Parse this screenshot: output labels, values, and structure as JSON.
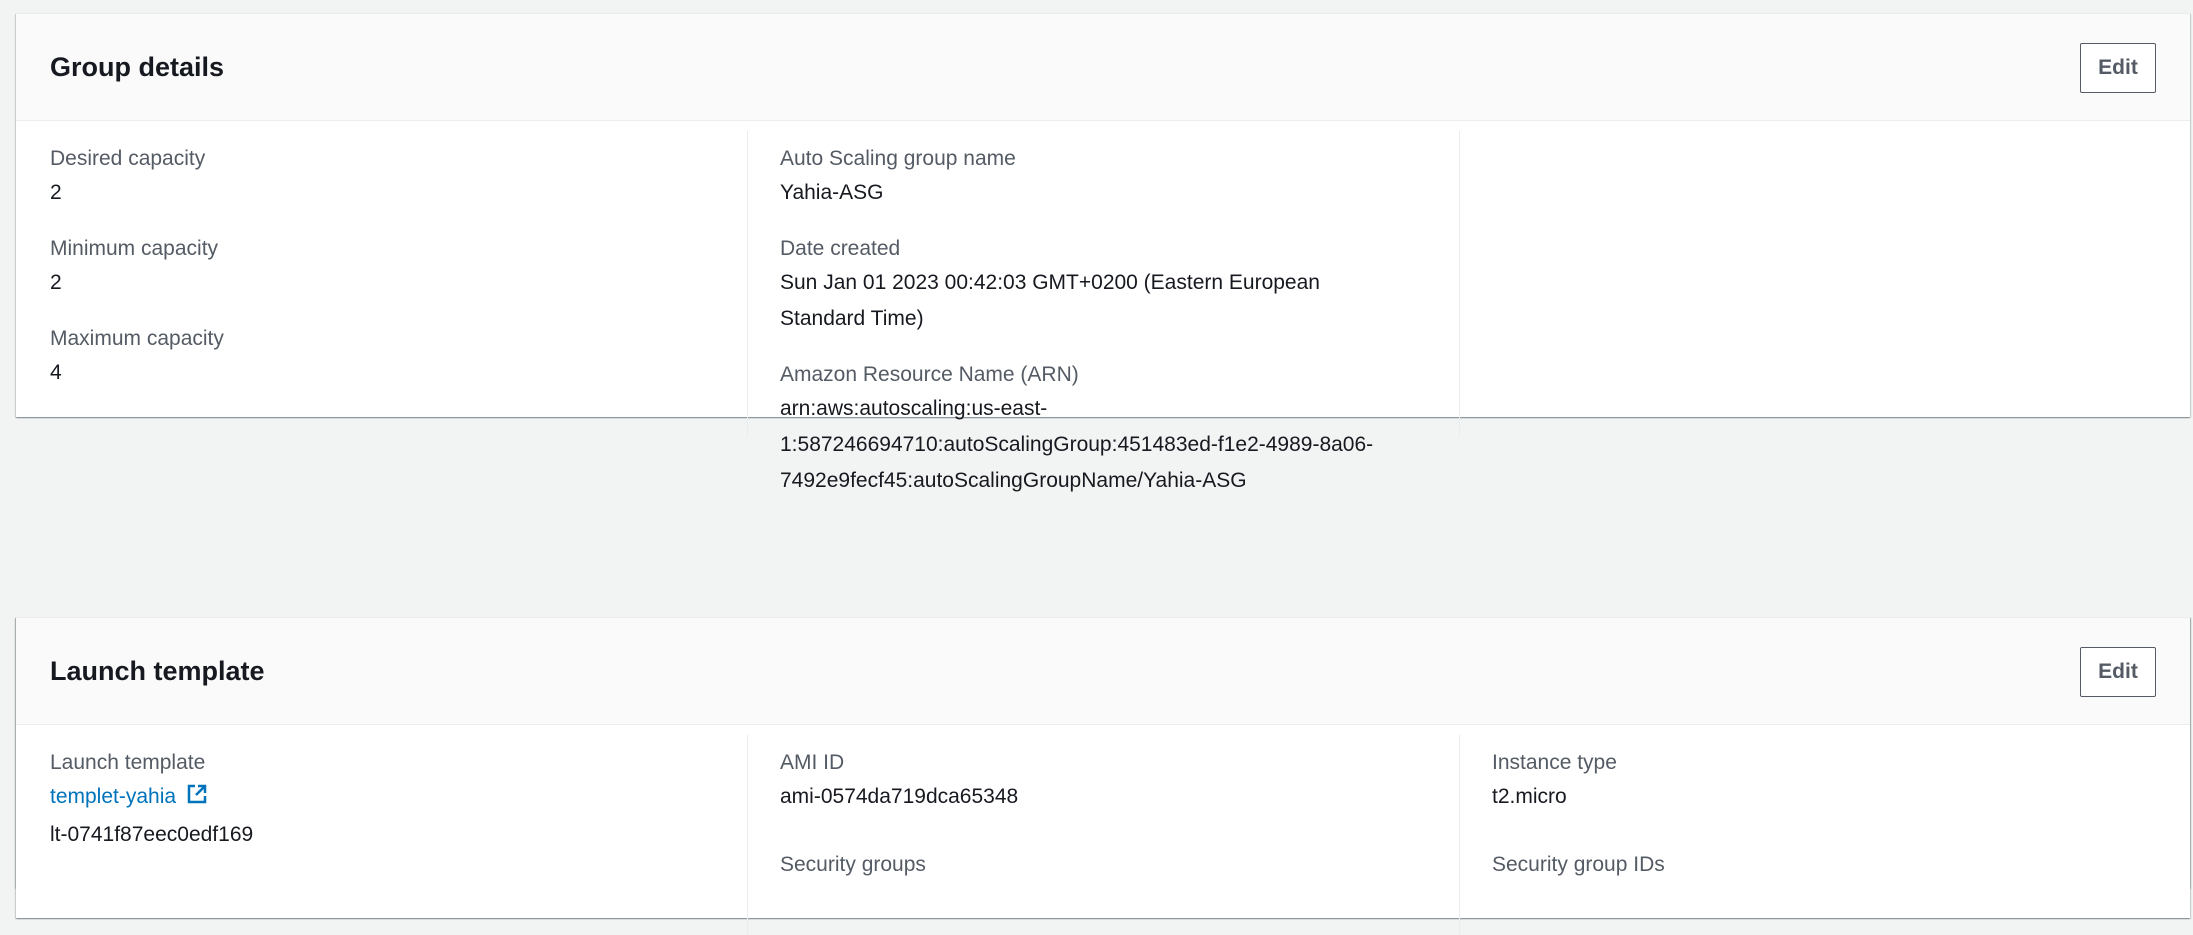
{
  "group_details": {
    "title": "Group details",
    "edit_label": "Edit",
    "col1": {
      "desired_capacity_label": "Desired capacity",
      "desired_capacity_value": "2",
      "minimum_capacity_label": "Minimum capacity",
      "minimum_capacity_value": "2",
      "maximum_capacity_label": "Maximum capacity",
      "maximum_capacity_value": "4"
    },
    "col2": {
      "asg_name_label": "Auto Scaling group name",
      "asg_name_value": "Yahia-ASG",
      "date_created_label": "Date created",
      "date_created_line1": "Sun Jan 01 2023 00:42:03 GMT+0200 (Eastern European",
      "date_created_line2": "Standard Time)",
      "arn_label": "Amazon Resource Name (ARN)",
      "arn_line1": "arn:aws:autoscaling:us-east-",
      "arn_line2": "1:587246694710:autoScalingGroup:451483ed-f1e2-4989-8a06-",
      "arn_line3": "7492e9fecf45:autoScalingGroupName/Yahia-ASG"
    }
  },
  "launch_template": {
    "title": "Launch template",
    "edit_label": "Edit",
    "col1": {
      "launch_template_label": "Launch template",
      "template_link": "templet-yahia",
      "template_id": "lt-0741f87eec0edf169"
    },
    "col2": {
      "ami_label": "AMI ID",
      "ami_value": "ami-0574da719dca65348",
      "security_groups_label": "Security groups"
    },
    "col3": {
      "instance_type_label": "Instance type",
      "instance_type_value": "t2.micro",
      "security_group_ids_label": "Security group IDs"
    }
  },
  "icons": {
    "external_link": "external-link-icon"
  },
  "colors": {
    "link": "#0073bb",
    "label": "#545b64",
    "text": "#16191f"
  }
}
